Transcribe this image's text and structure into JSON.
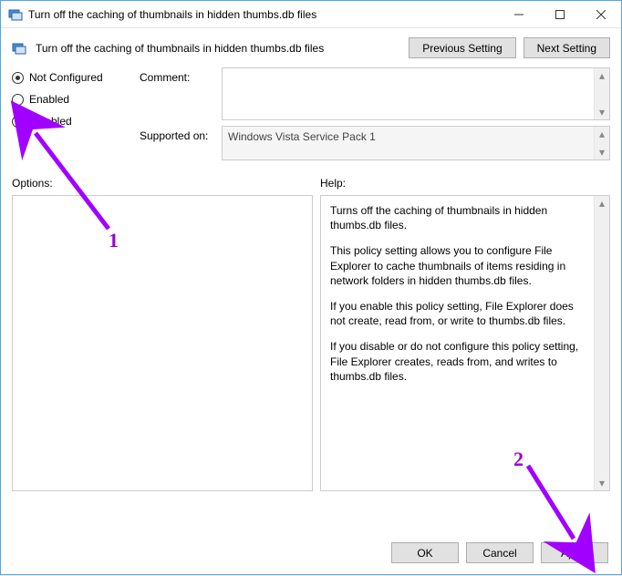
{
  "window": {
    "title": "Turn off the caching of thumbnails in hidden thumbs.db files"
  },
  "header": {
    "title": "Turn off the caching of thumbnails in hidden thumbs.db files",
    "prev_label": "Previous Setting",
    "next_label": "Next Setting"
  },
  "radios": {
    "not_configured": "Not Configured",
    "enabled": "Enabled",
    "disabled": "Disabled",
    "selected": "not_configured"
  },
  "fields": {
    "comment_label": "Comment:",
    "comment_value": "",
    "supported_label": "Supported on:",
    "supported_value": "Windows Vista Service Pack 1"
  },
  "sections": {
    "options_label": "Options:",
    "help_label": "Help:"
  },
  "help": {
    "p1": "Turns off the caching of thumbnails in hidden thumbs.db files.",
    "p2": "This policy setting allows you to configure File Explorer to cache thumbnails of items residing in network folders in hidden thumbs.db files.",
    "p3": "If you enable this policy setting, File Explorer does not create, read from, or write to thumbs.db files.",
    "p4": "If you disable or do not configure this policy setting, File Explorer creates, reads from, and writes to thumbs.db files."
  },
  "buttons": {
    "ok": "OK",
    "cancel": "Cancel",
    "apply": "Apply"
  },
  "annotations": {
    "n1": "1",
    "n2": "2"
  }
}
